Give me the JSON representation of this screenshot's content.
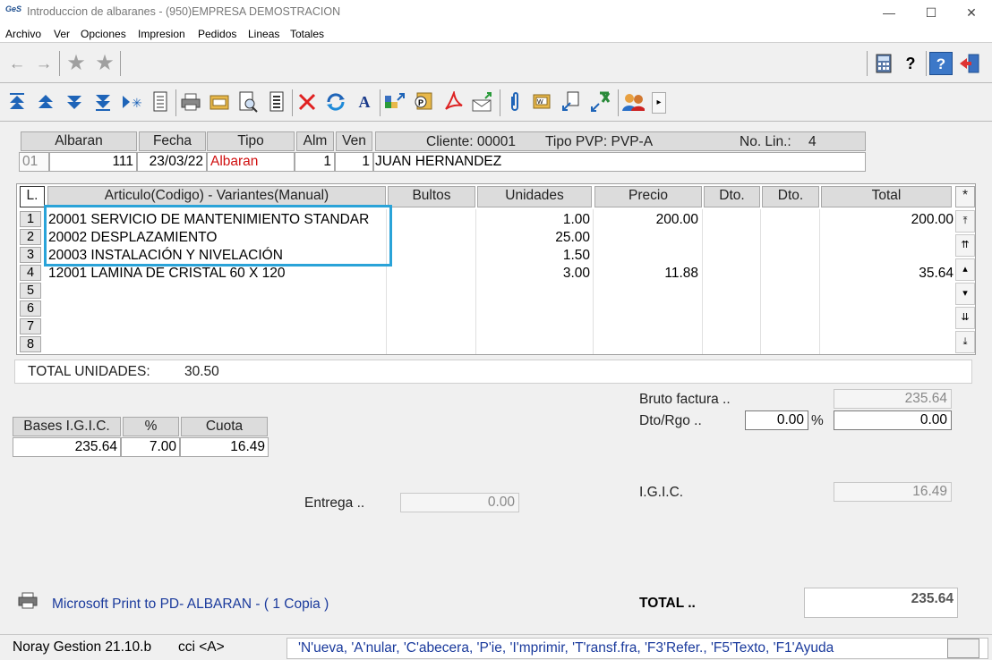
{
  "window": {
    "title": "Introduccion de albaranes -  (950)EMPRESA DEMOSTRACION",
    "app_logo": "GeS",
    "controls": {
      "minimize": "—",
      "maximize": "☐",
      "close": "✕"
    }
  },
  "menu": [
    "Archivo",
    "Ver",
    "Opciones",
    "Impresion",
    "Pedidos",
    "Lineas",
    "Totales"
  ],
  "toolbar1": [
    "back-arrow-icon",
    "forward-arrow-icon",
    "star-icon",
    "star-icon",
    "calculator-icon",
    "help-pointer-icon",
    "help-book-icon",
    "exit-door-icon"
  ],
  "toolbar1_glyphs": {
    "back": "←",
    "forward": "→",
    "star": "★",
    "help": "?",
    "help2": "?"
  },
  "toolbar2": [
    "first-record-icon",
    "previous-page-icon",
    "next-page-icon",
    "last-record-icon",
    "insert-icon",
    "document-icon",
    "print-icon",
    "folder-icon",
    "preview-icon",
    "list-icon",
    "delete-icon",
    "refresh-icon",
    "font-icon",
    "transfer-icon",
    "pvp-icon",
    "pdf-icon",
    "send-icon",
    "attach-icon",
    "note-icon",
    "copy-icon",
    "excel-icon",
    "users-icon",
    "more-icon"
  ],
  "header": {
    "labels": {
      "albaran": "Albaran",
      "fecha": "Fecha",
      "tipo": "Tipo",
      "alm": "Alm",
      "ven": "Ven"
    },
    "info": {
      "cliente": "Cliente: 00001",
      "tipo_pvp": "Tipo PVP: PVP-A",
      "no_lin": "No. Lin.:",
      "no_lin_value": "4"
    },
    "values": {
      "serie": "01",
      "albaran": "111",
      "fecha": "23/03/22",
      "tipo": "Albaran",
      "alm": "1",
      "ven": "1",
      "cliente_nombre": "JUAN HERNANDEZ"
    }
  },
  "lines_table": {
    "columns": [
      "L.",
      "Articulo(Codigo)  - Variantes(Manual)",
      "Bultos",
      "Unidades",
      "Precio",
      "Dto.",
      "Dto.",
      "Total",
      "*"
    ],
    "rows": [
      {
        "n": "1",
        "articulo": "20001 SERVICIO DE MANTENIMIENTO STANDAR",
        "unidades": "1.00",
        "precio": "200.00",
        "total": "200.00"
      },
      {
        "n": "2",
        "articulo": "20002 DESPLAZAMIENTO",
        "unidades": "25.00",
        "precio": "",
        "total": ""
      },
      {
        "n": "3",
        "articulo": "20003 INSTALACIÓN Y NIVELACIÓN",
        "unidades": "1.50",
        "precio": "",
        "total": ""
      },
      {
        "n": "4",
        "articulo": "12001 LAMINA DE CRISTAL 60 X 120",
        "unidades": "3.00",
        "precio": "11.88",
        "total": "35.64"
      },
      {
        "n": "5",
        "articulo": "",
        "unidades": "",
        "precio": "",
        "total": ""
      },
      {
        "n": "6",
        "articulo": "",
        "unidades": "",
        "precio": "",
        "total": ""
      },
      {
        "n": "7",
        "articulo": "",
        "unidades": "",
        "precio": "",
        "total": ""
      },
      {
        "n": "8",
        "articulo": "",
        "unidades": "",
        "precio": "",
        "total": ""
      }
    ],
    "scroll_glyphs": [
      "⤒",
      "⇈",
      "▴",
      "▾",
      "⇊",
      "⤓"
    ],
    "highlight_color": "#2aa3d8"
  },
  "totals": {
    "total_unidades_label": "TOTAL UNIDADES:",
    "total_unidades_value": "30.50",
    "bruto_label": "Bruto factura ..",
    "bruto_value": "235.64",
    "dto_label": "Dto/Rgo ..",
    "dto_pct": "0.00",
    "pct_sign": "%",
    "dto_value": "0.00",
    "igic_label": "I.G.I.C.",
    "igic_value": "16.49",
    "entrega_label": "Entrega ..",
    "entrega_value": "0.00",
    "total_label": "TOTAL ..",
    "total_value": "235.64"
  },
  "taxes": {
    "headers": [
      "Bases I.G.I.C.",
      "%",
      "Cuota"
    ],
    "row": {
      "base": "235.64",
      "pct": "7.00",
      "cuota": "16.49"
    }
  },
  "printer": {
    "text": "Microsoft Print to PD- ALBARAN - (  1 Copia )",
    "color": "#1a3a9c"
  },
  "statusbar": {
    "version": "Noray Gestion 21.10.b",
    "user": "cci <A>",
    "hints": "'N'ueva, 'A'nular, 'C'abecera, 'P'ie, 'I'mprimir, 'T'ransf.fra, 'F3'Refer., 'F5'Texto, 'F1'Ayuda",
    "hints_color": "#1a3a9c"
  }
}
